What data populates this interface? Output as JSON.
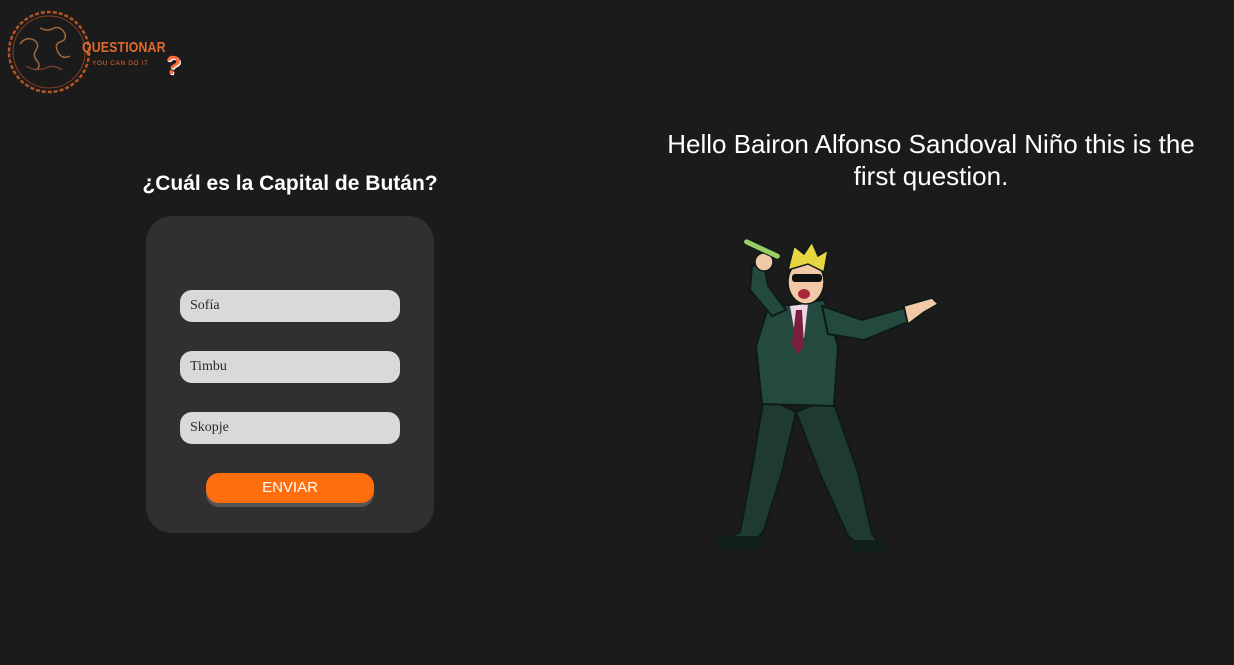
{
  "logo": {
    "title": "QUESTIONAR",
    "tagline": "YOU CAN DO IT",
    "mark": "?"
  },
  "quiz": {
    "question": "¿Cuál es la Capital de Bután?",
    "options": [
      "Sofía",
      "Timbu",
      "Skopje"
    ],
    "submit_label": "ENVIAR"
  },
  "greeting": "Hello Bairon Alfonso Sandoval Niño this is the first question.",
  "colors": {
    "background": "#1b1b1b",
    "card": "#303030",
    "accent": "#ff6d0c",
    "option_bg": "#d9d9d9"
  },
  "icons": {
    "logo": "globe-chain-icon",
    "illustration": "singing-man-in-suit"
  }
}
